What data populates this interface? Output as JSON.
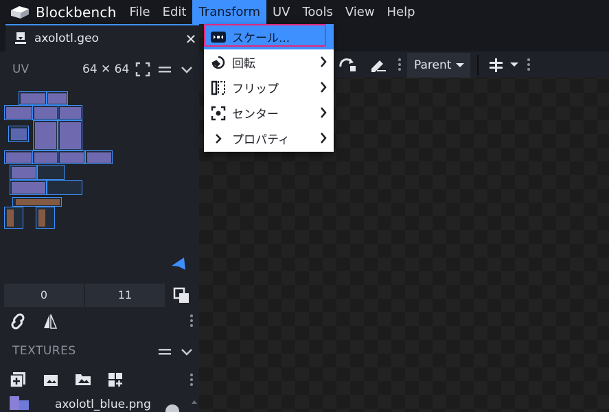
{
  "app": {
    "name": "Blockbench"
  },
  "menubar": {
    "items": [
      {
        "label": "File",
        "active": false
      },
      {
        "label": "Edit",
        "active": false
      },
      {
        "label": "Transform",
        "active": true
      },
      {
        "label": "UV",
        "active": false
      },
      {
        "label": "Tools",
        "active": false
      },
      {
        "label": "View",
        "active": false
      },
      {
        "label": "Help",
        "active": false
      }
    ]
  },
  "tab": {
    "label": "axolotl.geo",
    "close": "✕"
  },
  "uv_panel": {
    "title": "UV",
    "size": "64 ✕ 64",
    "field_a": "0",
    "field_b": "11"
  },
  "textures_panel": {
    "title": "TEXTURES",
    "item_name": "axolotl_blue.png"
  },
  "viewport": {
    "parent_select": "Parent"
  },
  "dropdown": {
    "items": [
      {
        "label": "スケール...",
        "icon": "scale-icon",
        "has_submenu": false,
        "highlighted": true
      },
      {
        "label": "回転",
        "icon": "rotate-icon",
        "has_submenu": true,
        "highlighted": false
      },
      {
        "label": "フリップ",
        "icon": "flip-icon",
        "has_submenu": true,
        "highlighted": false
      },
      {
        "label": "センター",
        "icon": "center-icon",
        "has_submenu": true,
        "highlighted": false
      },
      {
        "label": "プロパティ",
        "icon": "chevron-right-icon",
        "has_submenu": true,
        "highlighted": false
      }
    ]
  },
  "colors": {
    "accent": "#3e90ff",
    "highlight_frame": "#e6287a",
    "menubar": "#16181d",
    "panel": "#1f2228"
  }
}
